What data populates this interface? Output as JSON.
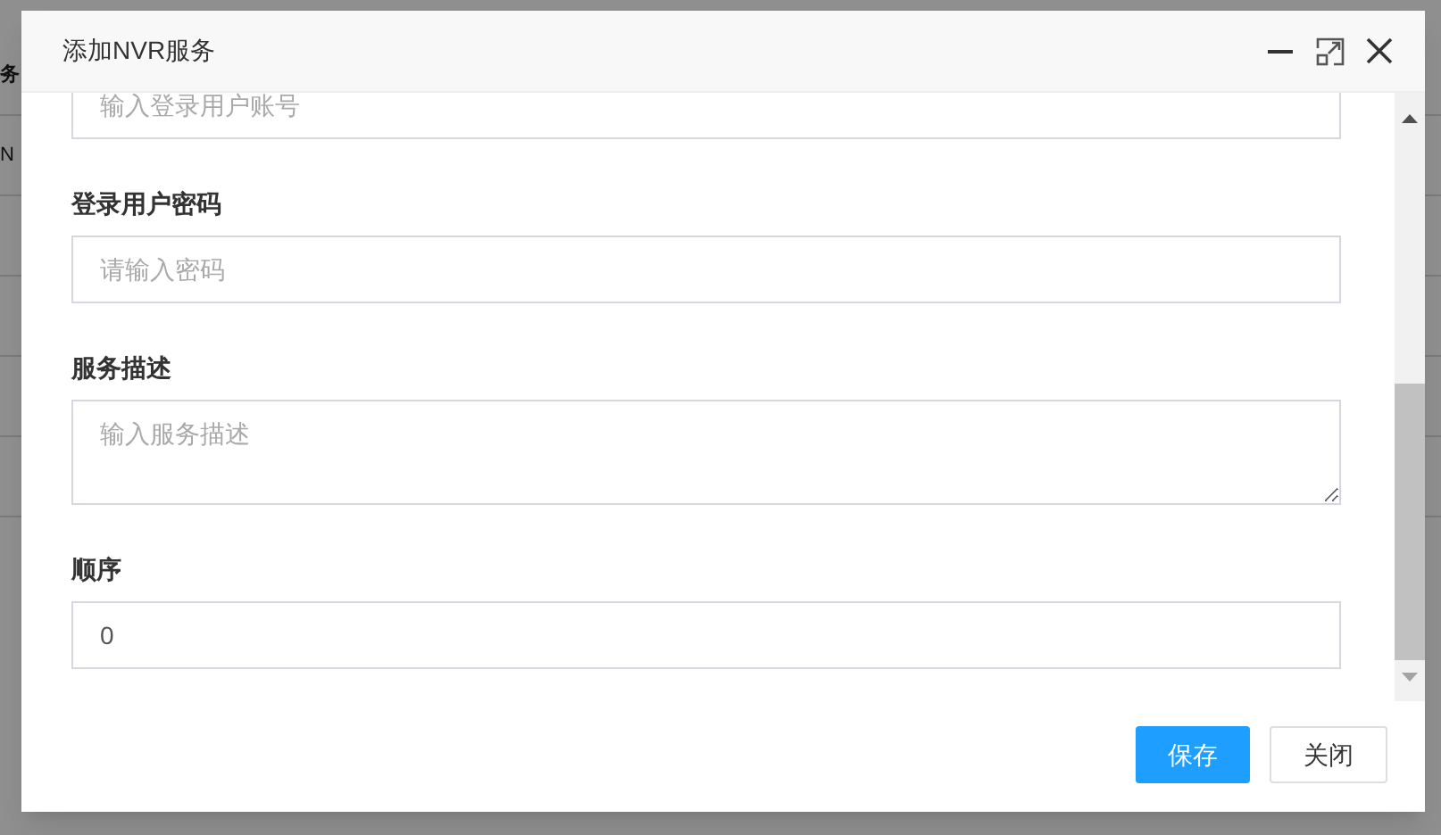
{
  "background": {
    "texts": [
      "务",
      "N"
    ]
  },
  "dialog": {
    "title": "添加NVR服务",
    "fields": [
      {
        "kind": "input",
        "placeholder": "输入登录用户账号"
      },
      {
        "kind": "input",
        "label": "登录用户密码",
        "placeholder": "请输入密码"
      },
      {
        "kind": "textarea",
        "label": "服务描述",
        "placeholder": "输入服务描述"
      },
      {
        "kind": "input",
        "label": "顺序",
        "value": "0"
      }
    ],
    "buttons": [
      {
        "label": "保存",
        "kind": "primary"
      },
      {
        "label": "关闭",
        "kind": "default"
      }
    ]
  }
}
